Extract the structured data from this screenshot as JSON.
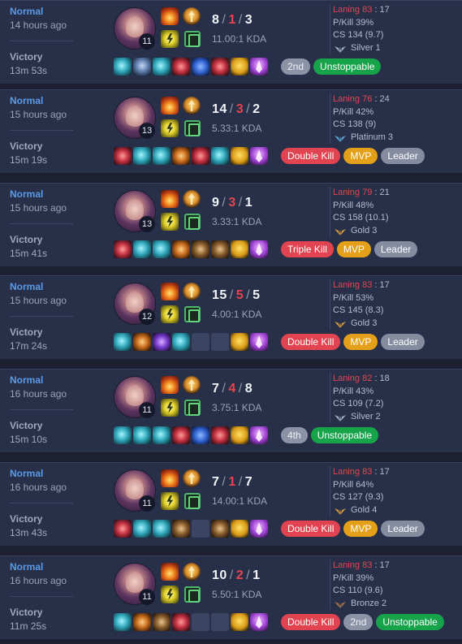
{
  "colors": {
    "background": "#1c2031",
    "card": "#283049",
    "mode_text": "#5b9ae6",
    "deaths": "#e5444f",
    "unstoppable": "#16a34a",
    "multi_kill": "#e24350",
    "mvp": "#e3a018",
    "leader": "#858c9f"
  },
  "tier_colors": {
    "Silver": "#9fb3c8",
    "Platinum": "#5aa8d9",
    "Gold": "#d79a3a",
    "Bronze": "#a9744a"
  },
  "matches": [
    {
      "mode": "Normal",
      "time_ago": "14 hours ago",
      "result": "Victory",
      "duration": "13m 53s",
      "level": "11",
      "kills": "8",
      "deaths": "1",
      "assists": "3",
      "kda_ratio": "11.00:1 KDA",
      "laning_label": "Laning 83",
      "laning_score": "17",
      "pkill": "P/Kill 39%",
      "cs": "CS 134 (9.7)",
      "tier": "Silver 1",
      "items": [
        "teal-item",
        "blue-shield-item",
        "teal-item",
        "red-item",
        "blue-item",
        "red-item",
        "crown",
        "ward"
      ],
      "badges": [
        {
          "label": "2nd",
          "kind": "rank"
        },
        {
          "label": "Unstoppable",
          "kind": "unstoppable"
        }
      ]
    },
    {
      "mode": "Normal",
      "time_ago": "15 hours ago",
      "result": "Victory",
      "duration": "15m 19s",
      "level": "13",
      "kills": "14",
      "deaths": "3",
      "assists": "2",
      "kda_ratio": "5.33:1 KDA",
      "laning_label": "Laning 76",
      "laning_score": "24",
      "pkill": "P/Kill 42%",
      "cs": "CS 138 (9)",
      "tier": "Platinum 3",
      "items": [
        "red-item",
        "teal-item",
        "teal-item",
        "orange-item",
        "red-item",
        "teal-item",
        "crown",
        "ward"
      ],
      "badges": [
        {
          "label": "Double Kill",
          "kind": "multi"
        },
        {
          "label": "MVP",
          "kind": "mvp"
        },
        {
          "label": "Leader",
          "kind": "leader"
        }
      ]
    },
    {
      "mode": "Normal",
      "time_ago": "15 hours ago",
      "result": "Victory",
      "duration": "15m 41s",
      "level": "13",
      "kills": "9",
      "deaths": "3",
      "assists": "1",
      "kda_ratio": "3.33:1 KDA",
      "laning_label": "Laning 79",
      "laning_score": "21",
      "pkill": "P/Kill 48%",
      "cs": "CS 158 (10.1)",
      "tier": "Gold 3",
      "items": [
        "red-item",
        "teal-item",
        "teal-item",
        "orange-item",
        "brown-item",
        "brown-item",
        "crown",
        "ward"
      ],
      "badges": [
        {
          "label": "Triple Kill",
          "kind": "multi"
        },
        {
          "label": "MVP",
          "kind": "mvp"
        },
        {
          "label": "Leader",
          "kind": "leader"
        }
      ]
    },
    {
      "mode": "Normal",
      "time_ago": "15 hours ago",
      "result": "Victory",
      "duration": "17m 24s",
      "level": "12",
      "kills": "15",
      "deaths": "5",
      "assists": "5",
      "kda_ratio": "4.00:1 KDA",
      "laning_label": "Laning 83",
      "laning_score": "17",
      "pkill": "P/Kill 53%",
      "cs": "CS 145 (8.3)",
      "tier": "Gold 3",
      "items": [
        "teal-item",
        "orange-item",
        "purple-item",
        "teal-item",
        "empty",
        "empty",
        "crown",
        "ward"
      ],
      "badges": [
        {
          "label": "Double Kill",
          "kind": "multi"
        },
        {
          "label": "MVP",
          "kind": "mvp"
        },
        {
          "label": "Leader",
          "kind": "leader"
        }
      ]
    },
    {
      "mode": "Normal",
      "time_ago": "16 hours ago",
      "result": "Victory",
      "duration": "15m 10s",
      "level": "11",
      "kills": "7",
      "deaths": "4",
      "assists": "8",
      "kda_ratio": "3.75:1 KDA",
      "laning_label": "Laning 82",
      "laning_score": "18",
      "pkill": "P/Kill 43%",
      "cs": "CS 109 (7.2)",
      "tier": "Silver 2",
      "items": [
        "teal-item",
        "teal-item",
        "teal-item",
        "red-item",
        "blue-item",
        "red-item",
        "crown",
        "ward"
      ],
      "badges": [
        {
          "label": "4th",
          "kind": "rank"
        },
        {
          "label": "Unstoppable",
          "kind": "unstoppable"
        }
      ]
    },
    {
      "mode": "Normal",
      "time_ago": "16 hours ago",
      "result": "Victory",
      "duration": "13m 43s",
      "level": "11",
      "kills": "7",
      "deaths": "1",
      "assists": "7",
      "kda_ratio": "14.00:1 KDA",
      "laning_label": "Laning 83",
      "laning_score": "17",
      "pkill": "P/Kill 64%",
      "cs": "CS 127 (9.3)",
      "tier": "Gold 4",
      "items": [
        "red-item",
        "teal-item",
        "teal-item",
        "brown-item",
        "empty",
        "brown-item",
        "crown",
        "ward"
      ],
      "badges": [
        {
          "label": "Double Kill",
          "kind": "multi"
        },
        {
          "label": "MVP",
          "kind": "mvp"
        },
        {
          "label": "Leader",
          "kind": "leader"
        }
      ]
    },
    {
      "mode": "Normal",
      "time_ago": "16 hours ago",
      "result": "Victory",
      "duration": "11m 25s",
      "level": "11",
      "kills": "10",
      "deaths": "2",
      "assists": "1",
      "kda_ratio": "5.50:1 KDA",
      "laning_label": "Laning 83",
      "laning_score": "17",
      "pkill": "P/Kill 39%",
      "cs": "CS 110 (9.6)",
      "tier": "Bronze 2",
      "items": [
        "teal-item",
        "orange-item",
        "brown-item",
        "red-item",
        "empty",
        "empty",
        "crown",
        "ward"
      ],
      "badges": [
        {
          "label": "Double Kill",
          "kind": "multi"
        },
        {
          "label": "2nd",
          "kind": "rank"
        },
        {
          "label": "Unstoppable",
          "kind": "unstoppable"
        }
      ]
    }
  ]
}
